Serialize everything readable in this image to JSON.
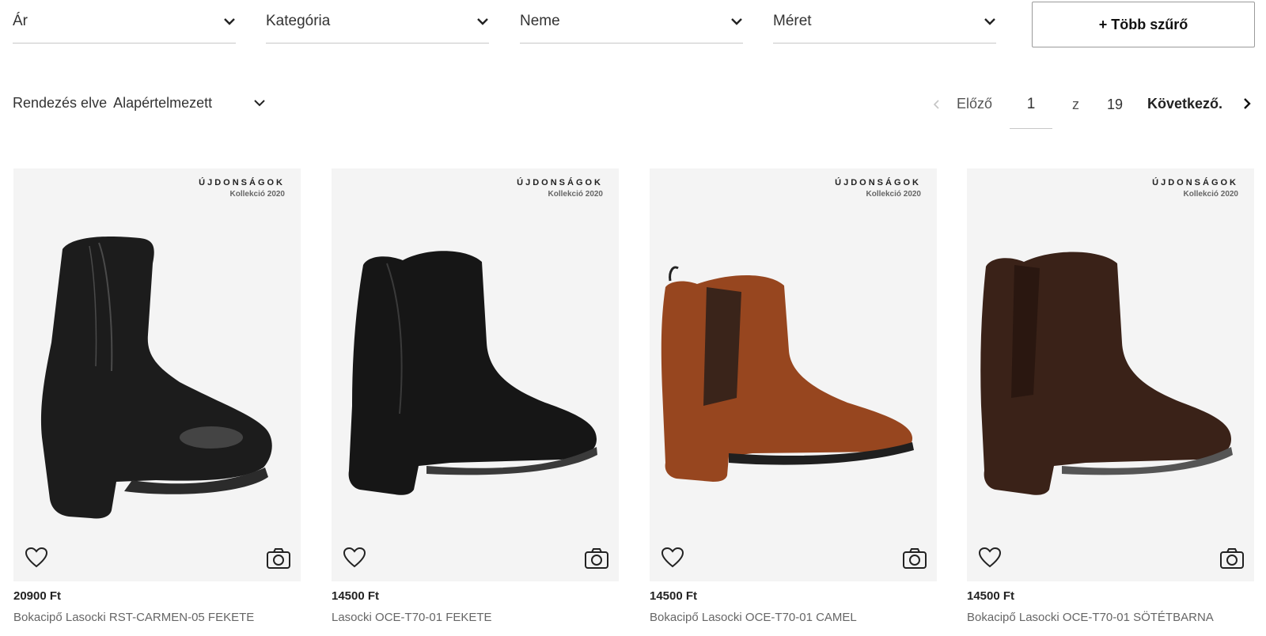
{
  "filters": {
    "price": "Ár",
    "category": "Kategória",
    "gender": "Neme",
    "size": "Méret",
    "more": "+ Több szűrő"
  },
  "sort": {
    "label": "Rendezés elve",
    "value": "Alapértelmezett"
  },
  "pagination": {
    "prev": "Előző",
    "current": "1",
    "of": "z",
    "total": "19",
    "next": "Következő."
  },
  "products": [
    {
      "badge_title": "ÚJDONSÁGOK",
      "badge_sub": "Kollekció 2020",
      "price": "20900 Ft",
      "name": "Bokacipő Lasocki RST-CARMEN-05 FEKETE",
      "color": "#1c1c1c"
    },
    {
      "badge_title": "ÚJDONSÁGOK",
      "badge_sub": "Kollekció 2020",
      "price": "14500 Ft",
      "name": "Lasocki OCE-T70-01 FEKETE",
      "color": "#161616"
    },
    {
      "badge_title": "ÚJDONSÁGOK",
      "badge_sub": "Kollekció 2020",
      "price": "14500 Ft",
      "name": "Bokacipő Lasocki OCE-T70-01 CAMEL",
      "color": "#97461f"
    },
    {
      "badge_title": "ÚJDONSÁGOK",
      "badge_sub": "Kollekció 2020",
      "price": "14500 Ft",
      "name": "Bokacipő Lasocki OCE-T70-01 SÖTÉTBARNA",
      "color": "#3a2218"
    }
  ],
  "icons": {
    "dropdown": "chevron-down-icon",
    "prev": "chevron-left-icon",
    "next": "chevron-right-icon",
    "favorite": "heart-icon",
    "photo": "camera-icon"
  }
}
